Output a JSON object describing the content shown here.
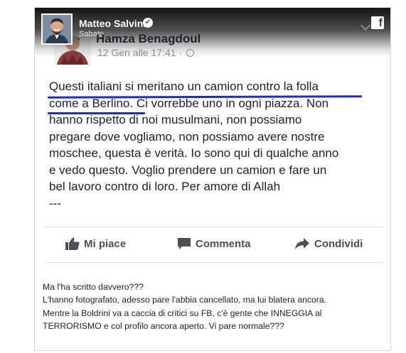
{
  "header": {
    "author": "Matteo Salvini",
    "date": "Sabato",
    "verified_glyph": "✔",
    "brand_glyph": "f"
  },
  "inner_post": {
    "author": "Hamza Benagdoul",
    "meta": "12 Gen alle 17:41 ·",
    "body_lines": [
      "Questi italiani si meritano un camion contro la folla",
      "come a Berlino. Ci vorrebbe uno in ogni piazza. Non",
      "hanno rispetto di noi musulmani, non possiamo",
      "pregare dove vogliamo, non possiamo avere nostre",
      "moschee, questa è verità. Io sono qui di qualche anno",
      "e vedo questo. Voglio prendere un camion e fare un",
      "bel lavoro contro di loro. Per amore di Allah",
      "---"
    ],
    "actions": {
      "like": "Mi piace",
      "comment": "Commenta",
      "share": "Condividi"
    }
  },
  "comment_lines": [
    "Ma l'ha scritto davvero???",
    "L'hanno fotografato, adesso pare l'abbia cancellato, ma lui blatera ancora.",
    "Mentre la Boldrini va a caccia di critici su FB, c'è gente che INNEGGIA al",
    "TERRORISMO e col profilo ancora aperto. Vi pare normale???"
  ],
  "colors": {
    "underline": "#1f2dbf",
    "text": "#1d2129",
    "meta": "#8a8d91",
    "action": "#4b4f56"
  }
}
